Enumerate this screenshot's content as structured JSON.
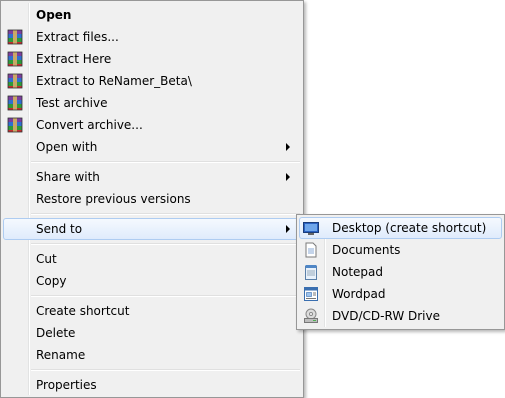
{
  "context_menu": {
    "items": [
      {
        "label": "Open",
        "icon": "",
        "bold": true
      },
      {
        "label": "Extract files...",
        "icon": "winrar-archive-icon"
      },
      {
        "label": "Extract Here",
        "icon": "winrar-archive-icon"
      },
      {
        "label": "Extract to ReNamer_Beta\\",
        "icon": "winrar-archive-icon"
      },
      {
        "label": "Test archive",
        "icon": "winrar-archive-icon"
      },
      {
        "label": "Convert archive...",
        "icon": "winrar-archive-icon"
      },
      {
        "label": "Open with",
        "icon": "",
        "submenu": true
      },
      {
        "label": "Share with",
        "icon": "",
        "submenu": true
      },
      {
        "label": "Restore previous versions",
        "icon": ""
      },
      {
        "label": "Send to",
        "icon": "",
        "submenu": true,
        "highlighted": true
      },
      {
        "label": "Cut",
        "icon": ""
      },
      {
        "label": "Copy",
        "icon": ""
      },
      {
        "label": "Create shortcut",
        "icon": ""
      },
      {
        "label": "Delete",
        "icon": ""
      },
      {
        "label": "Rename",
        "icon": ""
      },
      {
        "label": "Properties",
        "icon": ""
      }
    ]
  },
  "send_to_menu": {
    "items": [
      {
        "label": "Desktop (create shortcut)",
        "icon": "desktop-icon",
        "highlighted": true
      },
      {
        "label": "Documents",
        "icon": "documents-icon"
      },
      {
        "label": "Notepad",
        "icon": "notepad-icon"
      },
      {
        "label": "Wordpad",
        "icon": "wordpad-icon"
      },
      {
        "label": "DVD/CD-RW Drive",
        "icon": "dvd-drive-icon"
      }
    ]
  },
  "colors": {
    "menu_background": "#f0f0f0",
    "menu_border": "#979797",
    "highlight_border": "#aeccf1",
    "highlight_fill": "#dfebfc"
  }
}
